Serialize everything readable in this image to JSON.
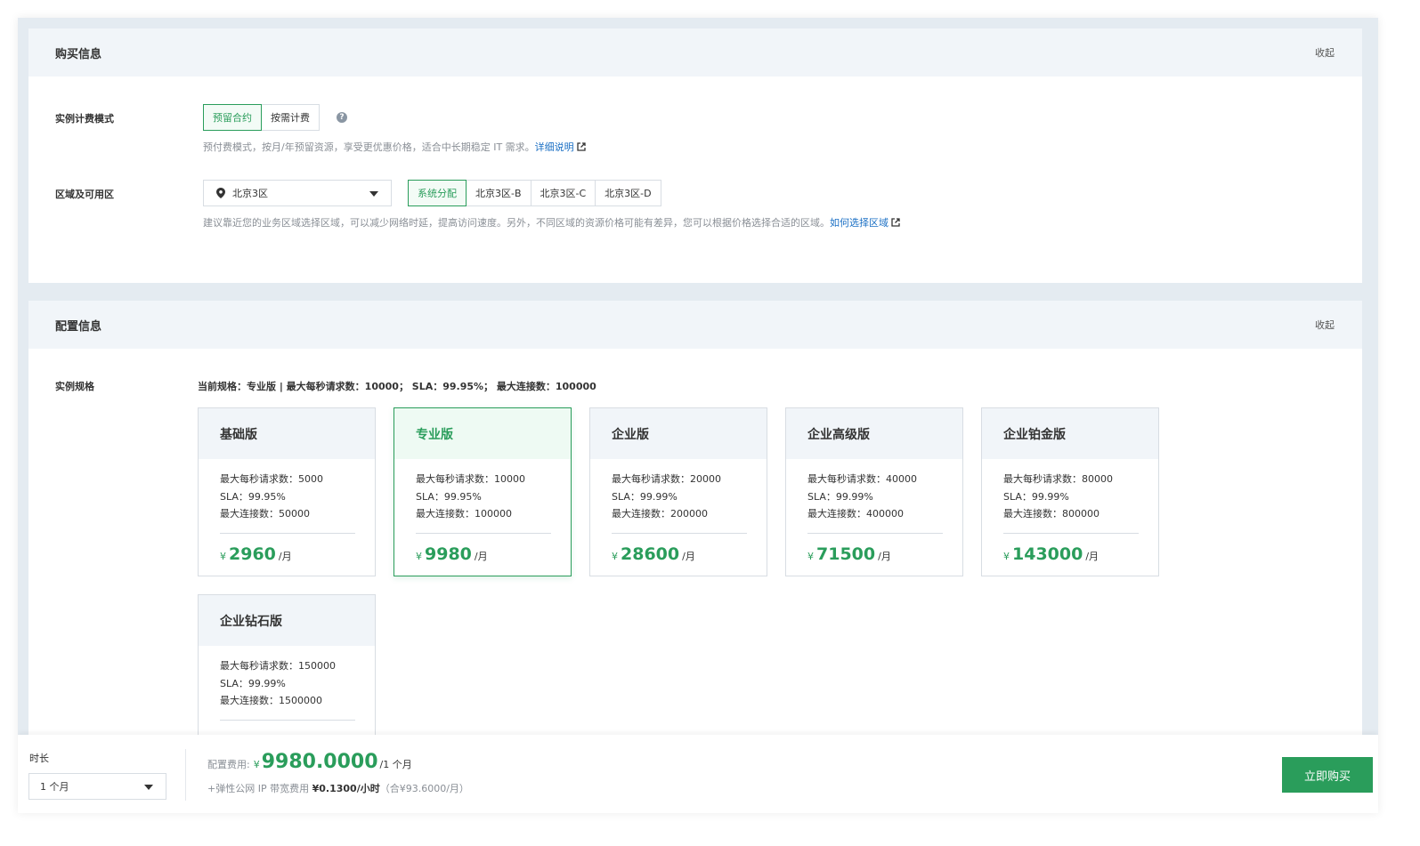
{
  "purchase": {
    "title": "购买信息",
    "collapse": "收起",
    "billing": {
      "label": "实例计费模式",
      "options": [
        "预留合约",
        "按需计费"
      ],
      "selected": 0,
      "hint": "预付费模式，按月/年预留资源，享受更优惠价格，适合中长期稳定 IT 需求。",
      "hint_link": "详细说明"
    },
    "region": {
      "label": "区域及可用区",
      "selected_region": "北京3区",
      "zones": [
        "系统分配",
        "北京3区-B",
        "北京3区-C",
        "北京3区-D"
      ],
      "selected_zone": 0,
      "hint": "建议靠近您的业务区域选择区域，可以减少网络时延，提高访问速度。另外，不同区域的资源价格可能有差异，您可以根据价格选择合适的区域。",
      "hint_link": "如何选择区域"
    }
  },
  "config": {
    "title": "配置信息",
    "collapse": "收起",
    "spec_label": "实例规格",
    "current_spec": "当前规格：专业版 | 最大每秒请求数：10000； SLA：99.95%； 最大连接数：100000",
    "plans": [
      {
        "name": "基础版",
        "qps": "最大每秒请求数：5000",
        "sla": "SLA：99.95%",
        "conn": "最大连接数：50000",
        "currency": "¥",
        "price": "2960",
        "unit": "/月"
      },
      {
        "name": "专业版",
        "qps": "最大每秒请求数：10000",
        "sla": "SLA：99.95%",
        "conn": "最大连接数：100000",
        "currency": "¥",
        "price": "9980",
        "unit": "/月"
      },
      {
        "name": "企业版",
        "qps": "最大每秒请求数：20000",
        "sla": "SLA：99.99%",
        "conn": "最大连接数：200000",
        "currency": "¥",
        "price": "28600",
        "unit": "/月"
      },
      {
        "name": "企业高级版",
        "qps": "最大每秒请求数：40000",
        "sla": "SLA：99.99%",
        "conn": "最大连接数：400000",
        "currency": "¥",
        "price": "71500",
        "unit": "/月"
      },
      {
        "name": "企业铂金版",
        "qps": "最大每秒请求数：80000",
        "sla": "SLA：99.99%",
        "conn": "最大连接数：800000",
        "currency": "¥",
        "price": "143000",
        "unit": "/月"
      },
      {
        "name": "企业钻石版",
        "qps": "最大每秒请求数：150000",
        "sla": "SLA：99.99%",
        "conn": "最大连接数：1500000",
        "currency": "",
        "price": "",
        "unit": ""
      }
    ],
    "selected_plan": 1
  },
  "footer": {
    "duration_label": "时长",
    "duration_value": "1 个月",
    "fee_label": "配置费用:",
    "fee_currency": "¥",
    "fee_amount": "9980.0000",
    "fee_period": "/1 个月",
    "extra_prefix": "+弹性公网 IP 带宽费用",
    "extra_rate": "¥0.1300/小时",
    "extra_note": "（合¥93.6000/月）",
    "buy_label": "立即购买"
  },
  "colors": {
    "accent": "#2a9d5b",
    "link": "#1a6fc4",
    "panel_head_bg": "#f1f5f9",
    "page_bg": "#e4ebf1"
  }
}
